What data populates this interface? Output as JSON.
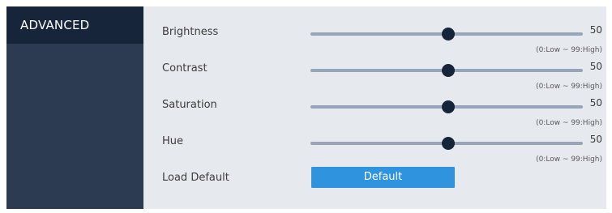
{
  "sidebar": {
    "header": "ADVANCED"
  },
  "sliders": [
    {
      "label": "Brightness",
      "value": "50",
      "range": "(0:Low ~ 99:High)",
      "level": 50,
      "min": 0,
      "max": 99
    },
    {
      "label": "Contrast",
      "value": "50",
      "range": "(0:Low ~ 99:High)",
      "level": 50,
      "min": 0,
      "max": 99
    },
    {
      "label": "Saturation",
      "value": "50",
      "range": "(0:Low ~ 99:High)",
      "level": 50,
      "min": 0,
      "max": 99
    },
    {
      "label": "Hue",
      "value": "50",
      "range": "(0:Low ~ 99:High)",
      "level": 50,
      "min": 0,
      "max": 99
    }
  ],
  "load_default": {
    "label": "Load Default",
    "button_label": "Default"
  },
  "colors": {
    "sidebar_bg": "#2d3b52",
    "sidebar_header_bg": "#17253b",
    "panel_bg": "#e6e9ee",
    "track": "#98a4ba",
    "thumb": "#17253b",
    "button": "#2f93dd"
  }
}
